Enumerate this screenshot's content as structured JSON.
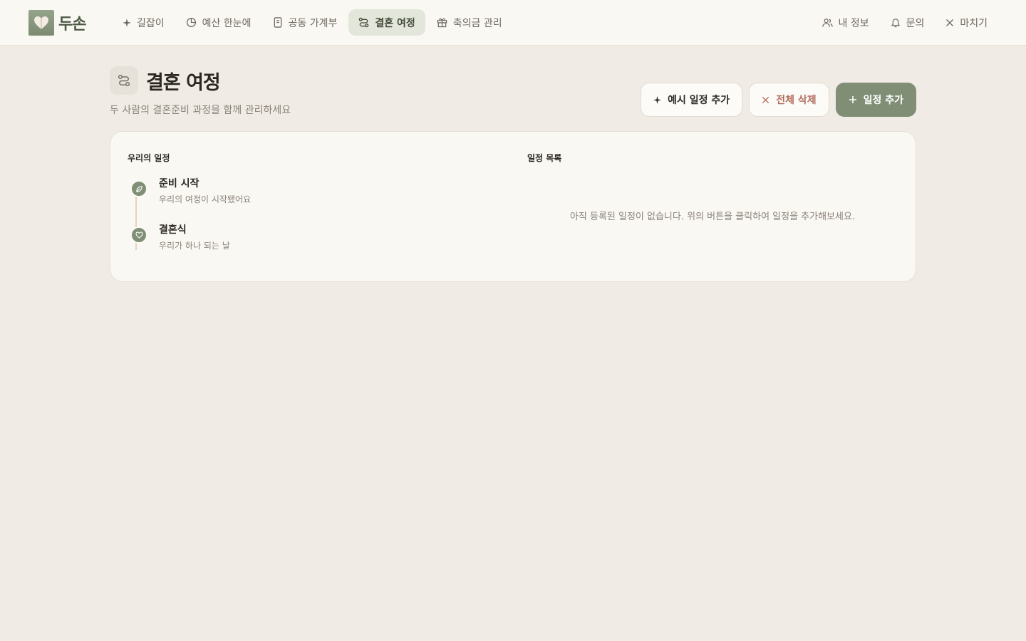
{
  "brand": {
    "name": "두손"
  },
  "nav": {
    "items": [
      {
        "label": "길잡이",
        "icon": "sparkle-icon"
      },
      {
        "label": "예산 한눈에",
        "icon": "pie-chart-icon"
      },
      {
        "label": "공동 가계부",
        "icon": "notebook-icon"
      },
      {
        "label": "결혼 여정",
        "icon": "route-icon",
        "active": true
      },
      {
        "label": "축의금 관리",
        "icon": "gift-icon"
      }
    ],
    "right": [
      {
        "label": "내 정보",
        "icon": "users-icon"
      },
      {
        "label": "문의",
        "icon": "bell-icon"
      },
      {
        "label": "마치기",
        "icon": "close-icon"
      }
    ]
  },
  "page": {
    "title": "결혼 여정",
    "subtitle": "두 사람의 결혼준비 과정을 함께 관리하세요"
  },
  "actions": {
    "sample": "예시 일정 추가",
    "delete_all": "전체 삭제",
    "add": "일정 추가"
  },
  "timeline": {
    "title": "우리의 일정",
    "items": [
      {
        "title": "준비 시작",
        "desc": "우리의 여정이 시작됐어요",
        "icon": "leaf-icon"
      },
      {
        "title": "결혼식",
        "desc": "우리가 하나 되는 날",
        "icon": "heart-icon"
      }
    ]
  },
  "schedule": {
    "title": "일정 목록",
    "empty": "아직 등록된 일정이 없습니다. 위의 버튼을 클릭하여 일정을 추가해보세요."
  },
  "colors": {
    "accent": "#7f8e74",
    "background": "#f0ebe4",
    "surface": "#faf8f3",
    "danger": "#b26d5c"
  }
}
